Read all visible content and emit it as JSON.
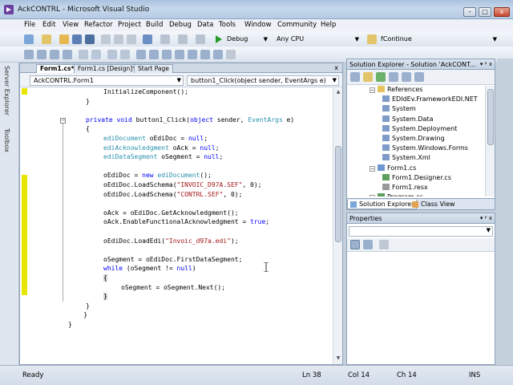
{
  "window": {
    "title": "AckCONTRL - Microsoft Visual Studio",
    "minimize": "–",
    "maximize": "□",
    "close": "x"
  },
  "menu": [
    "File",
    "Edit",
    "View",
    "Refactor",
    "Project",
    "Build",
    "Debug",
    "Data",
    "Tools",
    "Window",
    "Community",
    "Help"
  ],
  "toolbar": {
    "config": "Debug",
    "platform": "Any CPU",
    "find": "fContinue"
  },
  "side_tabs": [
    "Server Explorer",
    "Toolbox"
  ],
  "editor": {
    "tabs": [
      "Form1.cs*",
      "Form1.cs [Design]*",
      "Start Page"
    ],
    "close_glyph": "x",
    "class_combo": "AckCONTRL.Form1",
    "member_combo": "button1_Click(object sender, EventArgs e)"
  },
  "code": [
    {
      "indent": 2,
      "parts": [
        [
          "",
          "InitializeComponent();"
        ]
      ]
    },
    {
      "indent": 1,
      "parts": [
        [
          "",
          "}"
        ]
      ]
    },
    {
      "indent": 0,
      "parts": [
        [
          "",
          ""
        ]
      ]
    },
    {
      "indent": 1,
      "parts": [
        [
          "kw",
          "private void "
        ],
        [
          "",
          "button1_Click("
        ],
        [
          "kw",
          "object "
        ],
        [
          "",
          "sender, "
        ],
        [
          "ty",
          "EventArgs "
        ],
        [
          "",
          "e)"
        ]
      ]
    },
    {
      "indent": 1,
      "parts": [
        [
          "",
          "{"
        ]
      ]
    },
    {
      "indent": 2,
      "parts": [
        [
          "ty",
          "ediDocument "
        ],
        [
          "",
          "oEdiDoc = "
        ],
        [
          "kw",
          "null"
        ],
        [
          "",
          ";"
        ]
      ]
    },
    {
      "indent": 2,
      "parts": [
        [
          "ty",
          "ediAcknowledgment "
        ],
        [
          "",
          "oAck = "
        ],
        [
          "kw",
          "null"
        ],
        [
          "",
          ";"
        ]
      ]
    },
    {
      "indent": 2,
      "parts": [
        [
          "ty",
          "ediDataSegment "
        ],
        [
          "",
          "oSegment = "
        ],
        [
          "kw",
          "null"
        ],
        [
          "",
          ";"
        ]
      ]
    },
    {
      "indent": 0,
      "parts": [
        [
          "",
          ""
        ]
      ]
    },
    {
      "indent": 2,
      "parts": [
        [
          "",
          "oEdiDoc = "
        ],
        [
          "kw",
          "new "
        ],
        [
          "ty",
          "ediDocument"
        ],
        [
          "",
          "();"
        ]
      ]
    },
    {
      "indent": 2,
      "parts": [
        [
          "",
          "oEdiDoc.LoadSchema("
        ],
        [
          "st",
          "\"INVOIC_D97A.SEF\""
        ],
        [
          "",
          ", 0);"
        ]
      ]
    },
    {
      "indent": 2,
      "parts": [
        [
          "",
          "oEdiDoc.LoadSchema("
        ],
        [
          "st",
          "\"CONTRL.SEF\""
        ],
        [
          "",
          ", 0);"
        ]
      ]
    },
    {
      "indent": 0,
      "parts": [
        [
          "",
          ""
        ]
      ]
    },
    {
      "indent": 2,
      "parts": [
        [
          "",
          "oAck = oEdiDoc.GetAcknowledgment();"
        ]
      ]
    },
    {
      "indent": 2,
      "parts": [
        [
          "",
          "oAck.EnableFunctionalAcknowledgment = "
        ],
        [
          "kw",
          "true"
        ],
        [
          "",
          ";"
        ]
      ]
    },
    {
      "indent": 0,
      "parts": [
        [
          "",
          ""
        ]
      ]
    },
    {
      "indent": 2,
      "parts": [
        [
          "",
          "oEdiDoc.LoadEdi("
        ],
        [
          "st",
          "\"Invoic_d97a.edi\""
        ],
        [
          "",
          ");"
        ]
      ]
    },
    {
      "indent": 0,
      "parts": [
        [
          "",
          ""
        ]
      ]
    },
    {
      "indent": 2,
      "parts": [
        [
          "",
          "oSegment = oEdiDoc.FirstDataSegment;"
        ]
      ]
    },
    {
      "indent": 2,
      "parts": [
        [
          "kw",
          "while "
        ],
        [
          "",
          "(oSegment != "
        ],
        [
          "kw",
          "null"
        ],
        [
          "",
          ")"
        ]
      ]
    },
    {
      "indent": 2,
      "parts": [
        [
          "hl",
          "{"
        ]
      ]
    },
    {
      "indent": 3,
      "parts": [
        [
          "",
          "oSegment = oSegment.Next();"
        ]
      ]
    },
    {
      "indent": 2,
      "parts": [
        [
          "hl",
          "}"
        ]
      ]
    },
    {
      "indent": 1,
      "parts": [
        [
          "",
          "}"
        ]
      ]
    },
    {
      "indent": 0,
      "parts": [
        [
          "",
          "    }"
        ]
      ]
    },
    {
      "indent": 0,
      "parts": [
        [
          "",
          "}"
        ]
      ]
    }
  ],
  "solution_explorer": {
    "title": "Solution Explorer - Solution 'AckCONT...",
    "title_buttons": "▾ ᵖ x",
    "items": [
      {
        "label": "References",
        "level": 1,
        "icon": "references-folder-icon"
      },
      {
        "label": "EDIdEv.FrameworkEDI.NET",
        "level": 2,
        "icon": "reference-icon"
      },
      {
        "label": "System",
        "level": 2,
        "icon": "reference-icon"
      },
      {
        "label": "System.Data",
        "level": 2,
        "icon": "reference-icon"
      },
      {
        "label": "System.Deployment",
        "level": 2,
        "icon": "reference-icon"
      },
      {
        "label": "System.Drawing",
        "level": 2,
        "icon": "reference-icon"
      },
      {
        "label": "System.Windows.Forms",
        "level": 2,
        "icon": "reference-icon"
      },
      {
        "label": "System.Xml",
        "level": 2,
        "icon": "reference-icon"
      },
      {
        "label": "Form1.cs",
        "level": 1,
        "icon": "form-file-icon"
      },
      {
        "label": "Form1.Designer.cs",
        "level": 2,
        "icon": "cs-file-icon"
      },
      {
        "label": "Form1.resx",
        "level": 2,
        "icon": "resx-file-icon"
      },
      {
        "label": "Program.cs",
        "level": 1,
        "icon": "cs-file-icon"
      }
    ],
    "tabs": [
      "Solution Explorer",
      "Class View"
    ]
  },
  "properties": {
    "title": "Properties",
    "title_buttons": "▾ ᵖ x"
  },
  "status": {
    "ready": "Ready",
    "ln": "Ln 38",
    "col": "Col 14",
    "ch": "Ch 14",
    "ins": "INS"
  },
  "colors": {
    "keyword": "#0000ff",
    "type": "#2b91af",
    "string": "#a31515",
    "change_marker": "#e6e600"
  }
}
